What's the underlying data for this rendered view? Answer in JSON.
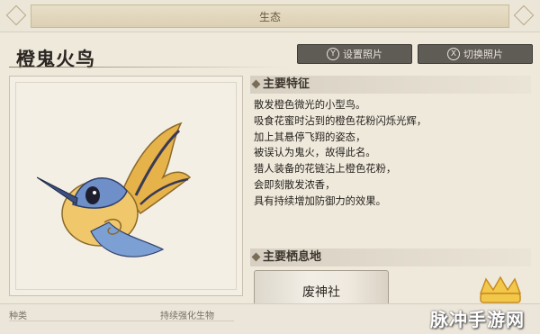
{
  "header": {
    "title": "生态"
  },
  "creature": {
    "name": "橙鬼火鸟"
  },
  "buttons": {
    "set_photo": {
      "key": "Y",
      "label": "设置照片"
    },
    "switch_photo": {
      "key": "X",
      "label": "切换照片"
    }
  },
  "features": {
    "heading": "主要特征",
    "lines": [
      "散发橙色微光的小型鸟。",
      "吸食花蜜时沾到的橙色花粉闪烁光辉，",
      "加上其悬停飞翔的姿态，",
      "被误认为鬼火，故得此名。",
      "猎人装备的花链沾上橙色花粉，",
      "会即刻散发浓香，",
      "具有持续增加防御力的效果。"
    ]
  },
  "habitat": {
    "heading": "主要栖息地",
    "location": "废神社"
  },
  "info": {
    "label": "种类",
    "value": "持续强化生物"
  },
  "watermark": {
    "text": "脉冲手游网"
  },
  "colors": {
    "button_bg": "#5f5b55",
    "paper": "#efe9dc",
    "accent_orange": "#e8b040"
  }
}
